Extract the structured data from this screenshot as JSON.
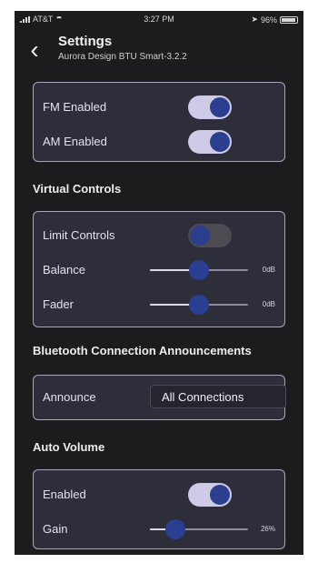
{
  "status_bar": {
    "carrier": "AT&T",
    "time": "3:27 PM",
    "battery": "96%"
  },
  "nav": {
    "title": "Settings",
    "subtitle": "Aurora Design BTU Smart-3.2.2",
    "back_icon": "chevron-left-icon"
  },
  "radio": {
    "fm_label": "FM Enabled",
    "fm_on": true,
    "am_label": "AM Enabled",
    "am_on": true
  },
  "virtual_controls": {
    "header": "Virtual Controls",
    "limit_label": "Limit Controls",
    "limit_on": false,
    "balance_label": "Balance",
    "balance_value": "0dB",
    "balance_level": 0.5,
    "fader_label": "Fader",
    "fader_value": "0dB",
    "fader_level": 0.5
  },
  "bluetooth": {
    "header": "Bluetooth Connection Announcements",
    "announce_label": "Announce",
    "announce_value": "All Connections"
  },
  "auto_volume": {
    "header": "Auto Volume",
    "enabled_label": "Enabled",
    "enabled_on": true,
    "gain_label": "Gain",
    "gain_value": "26%",
    "gain_level": 0.26
  },
  "colors": {
    "card": "#2e2d3a",
    "toggle_on": "#cdcbe6",
    "knob": "#2c3f8e",
    "border": "#a9a6bc"
  }
}
